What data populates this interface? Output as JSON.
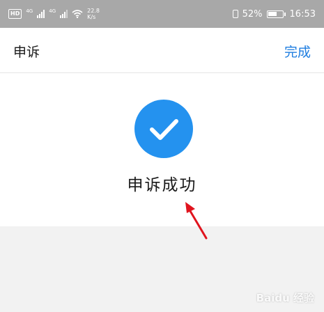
{
  "status_bar": {
    "hd_label": "HD",
    "net1": "4G",
    "net2": "4G",
    "speed_value": "22.8",
    "speed_unit": "K/s",
    "battery": "52%",
    "time": "16:53"
  },
  "header": {
    "title": "申诉",
    "done_label": "完成"
  },
  "result": {
    "message": "申诉成功",
    "icon": "check-icon",
    "accent_color": "#2492ef"
  },
  "annotation": {
    "arrow_color": "#e0141e"
  },
  "watermark": {
    "text": "Baidu 经验"
  }
}
